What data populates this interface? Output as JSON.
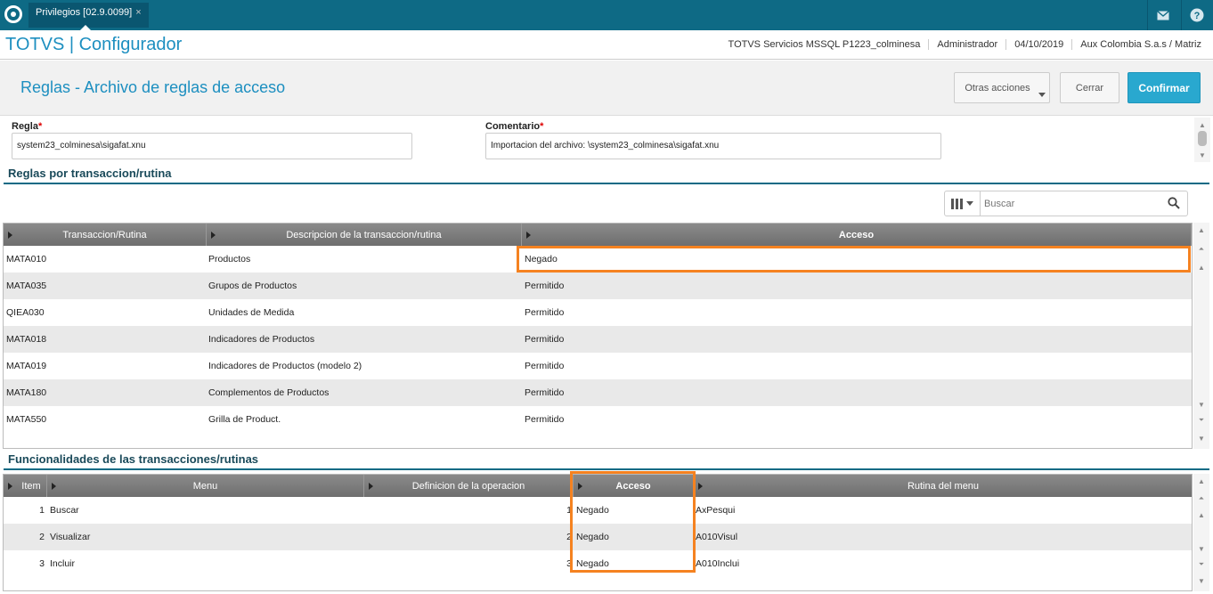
{
  "topbar": {
    "tab_label": "Privilegios [02.9.0099]",
    "tab_close": "×",
    "icons": [
      "logo-icon",
      "mail-icon",
      "help-icon"
    ]
  },
  "header": {
    "app_title": "TOTVS | Configurador",
    "db": "TOTVS Servicios MSSQL P1223_colminesa",
    "user": "Administrador",
    "date": "04/10/2019",
    "company": "Aux Colombia S.a.s / Matriz"
  },
  "toolbar": {
    "page_title": "Reglas - Archivo de reglas de acceso",
    "more_actions_label": "Otras acciones",
    "close_label": "Cerrar",
    "confirm_label": "Confirmar"
  },
  "form": {
    "regla_label": "Regla",
    "regla_value": "system23_colminesa\\sigafat.xnu",
    "comentario_label": "Comentario",
    "comentario_value": "Importacion del archivo: \\system23_colminesa\\sigafat.xnu",
    "required_mark": "*"
  },
  "rules_section": {
    "title": "Reglas por transaccion/rutina",
    "search_placeholder": "Buscar",
    "columns": [
      "Transaccion/Rutina",
      "Descripcion de la transaccion/rutina",
      "Acceso"
    ],
    "rows": [
      {
        "code": "MATA010",
        "desc": "Productos",
        "access": "Negado"
      },
      {
        "code": "MATA035",
        "desc": "Grupos de Productos",
        "access": "Permitido"
      },
      {
        "code": "QIEA030",
        "desc": "Unidades de Medida",
        "access": "Permitido"
      },
      {
        "code": "MATA018",
        "desc": "Indicadores de Productos",
        "access": "Permitido"
      },
      {
        "code": "MATA019",
        "desc": "Indicadores de Productos (modelo 2)",
        "access": "Permitido"
      },
      {
        "code": "MATA180",
        "desc": "Complementos de Productos",
        "access": "Permitido"
      },
      {
        "code": "MATA550",
        "desc": "Grilla de Product.",
        "access": "Permitido"
      }
    ]
  },
  "func_section": {
    "title": "Funcionalidades de las transacciones/rutinas",
    "columns": [
      "Item",
      "Menu",
      "Definicion de la operacion",
      "Acceso",
      "Rutina del menu"
    ],
    "rows": [
      {
        "item": "1",
        "menu": "Buscar",
        "def": "1",
        "access": "Negado",
        "routine": "AxPesqui"
      },
      {
        "item": "2",
        "menu": "Visualizar",
        "def": "2",
        "access": "Negado",
        "routine": "A010Visul"
      },
      {
        "item": "3",
        "menu": "Incluir",
        "def": "3",
        "access": "Negado",
        "routine": "A010Inclui"
      }
    ]
  },
  "colors": {
    "topbar": "#0e6a85",
    "accent": "#1d8fc0",
    "primary_button": "#29a8cf",
    "highlight": "#f58220"
  }
}
